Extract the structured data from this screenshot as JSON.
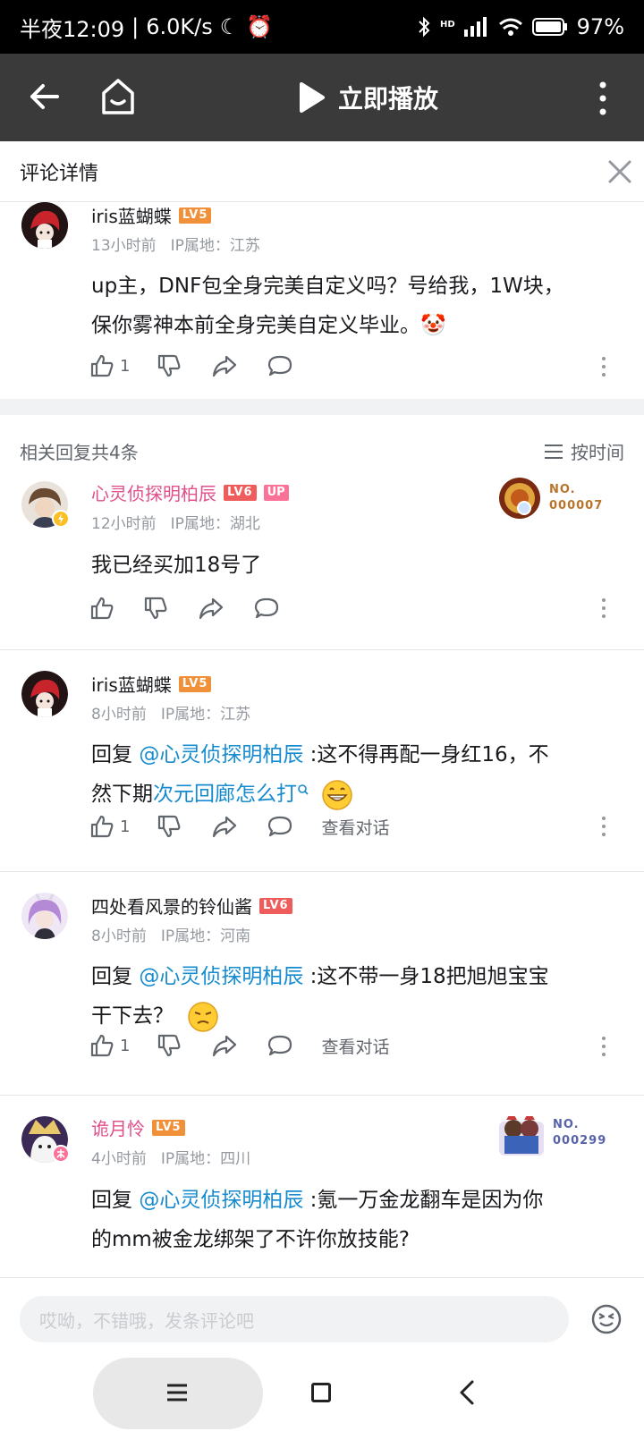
{
  "status": {
    "time": "半夜12:09",
    "speed": "6.0K/s",
    "battery": "97%",
    "hd": "HD"
  },
  "toolbar": {
    "play_label": "立即播放"
  },
  "header": {
    "title": "评论详情"
  },
  "root_comment": {
    "name": "iris蓝蝴蝶",
    "level": "LV5",
    "time": "13小时前",
    "ip": "IP属地：江苏",
    "text_line1": "up主，DNF包全身完美自定义吗？号给我，1W块，",
    "text_line2": "保你雾神本前全身完美自定义毕业。🤡",
    "likes": "1"
  },
  "related": {
    "count_label": "相关回复共4条",
    "sort_label": "按时间"
  },
  "replies": [
    {
      "name": "心灵侦探明柏辰",
      "level": "LV6",
      "up_badge": "UP",
      "time": "12小时前",
      "ip": "IP属地：湖北",
      "text": "我已经买加18号了",
      "medal_no_label": "NO.",
      "medal_no": "000007"
    },
    {
      "name": "iris蓝蝴蝶",
      "level": "LV5",
      "time": "8小时前",
      "ip": "IP属地：江苏",
      "reply_prefix": "回复 ",
      "mention": "@心灵侦探明柏辰",
      "text_after_mention": " :这不得再配一身红16，不",
      "text_line2_prefix": "然下期",
      "search_link": "次元回廊怎么打",
      "likes": "1",
      "view_dialog": "查看对话"
    },
    {
      "name": "四处看风景的铃仙酱",
      "level": "LV6",
      "time": "8小时前",
      "ip": "IP属地：河南",
      "reply_prefix": "回复 ",
      "mention": "@心灵侦探明柏辰",
      "text_after_mention": " :这不带一身18把旭旭宝宝",
      "text_line2": "干下去？",
      "likes": "1",
      "view_dialog": "查看对话"
    },
    {
      "name": "诡月怜",
      "level": "LV5",
      "time": "4小时前",
      "ip": "IP属地：四川",
      "reply_prefix": "回复 ",
      "mention": "@心灵侦探明柏辰",
      "text_after_mention": " :氪一万金龙翻车是因为你",
      "text_line2": "的mm被金龙绑架了不许你放技能?",
      "medal_no_label": "NO.",
      "medal_no": "000299"
    }
  ],
  "input": {
    "placeholder": "哎呦，不错哦，发条评论吧"
  },
  "colors": {
    "lv5": "#f0913a",
    "lv6": "#ee5c5c",
    "mention": "#178bcf",
    "vip_name": "#e0508a"
  }
}
